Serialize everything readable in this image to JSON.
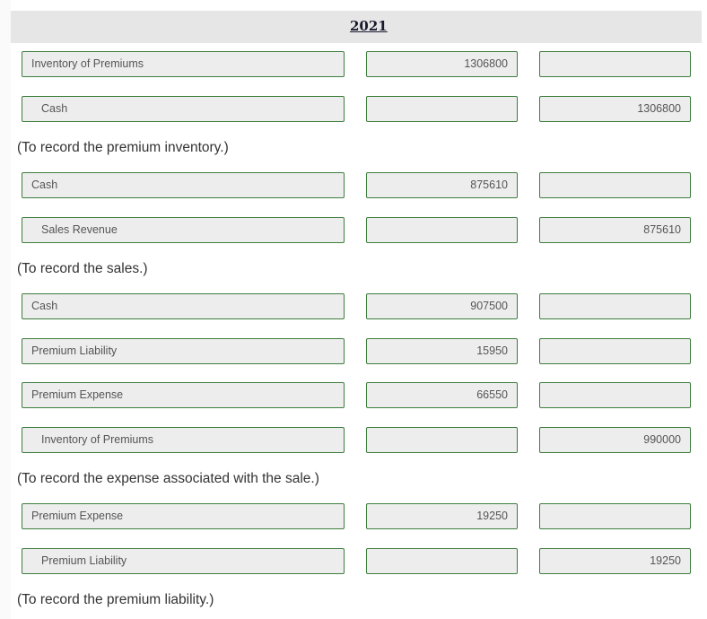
{
  "header": {
    "year": "2021"
  },
  "entries": [
    {
      "lines": [
        {
          "account": "Inventory of Premiums",
          "debit": "1306800",
          "credit": ""
        },
        {
          "account": "Cash",
          "debit": "",
          "credit": "1306800"
        }
      ],
      "note": "(To record the premium inventory.)"
    },
    {
      "lines": [
        {
          "account": "Cash",
          "debit": "875610",
          "credit": ""
        },
        {
          "account": "Sales Revenue",
          "debit": "",
          "credit": "875610"
        }
      ],
      "note": "(To record the sales.)"
    },
    {
      "lines": [
        {
          "account": "Cash",
          "debit": "907500",
          "credit": ""
        },
        {
          "account": "Premium Liability",
          "debit": "15950",
          "credit": ""
        },
        {
          "account": "Premium Expense",
          "debit": "66550",
          "credit": ""
        },
        {
          "account": "Inventory of Premiums",
          "debit": "",
          "credit": "990000"
        }
      ],
      "note": "(To record the expense associated with the sale.)"
    },
    {
      "lines": [
        {
          "account": "Premium Expense",
          "debit": "19250",
          "credit": ""
        },
        {
          "account": "Premium Liability",
          "debit": "",
          "credit": "19250"
        }
      ],
      "note": "(To record the premium liability.)"
    }
  ]
}
